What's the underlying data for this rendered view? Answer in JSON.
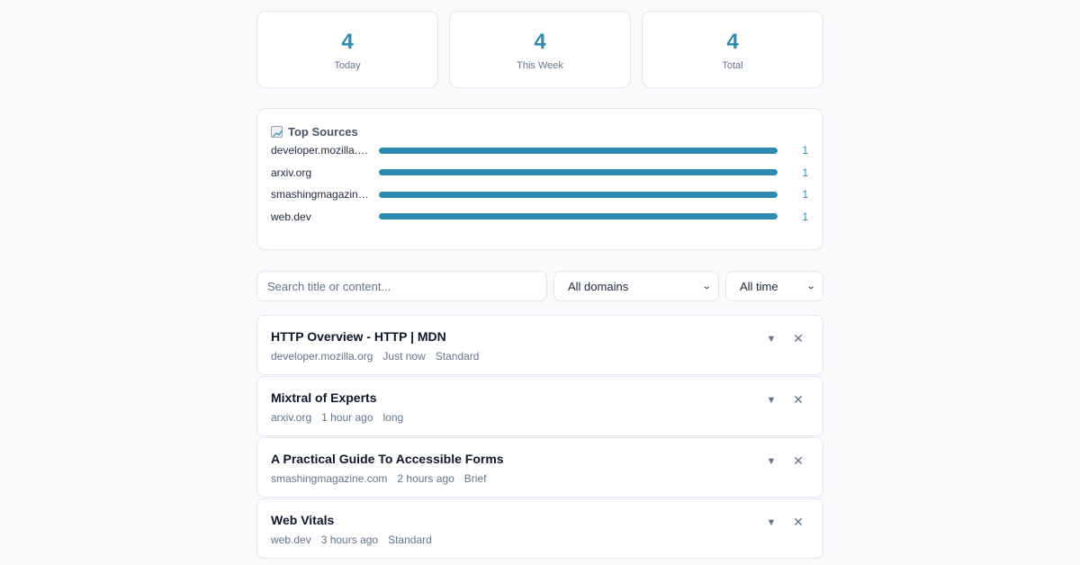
{
  "stats": [
    {
      "value": "4",
      "label": "Today"
    },
    {
      "value": "4",
      "label": "This Week"
    },
    {
      "value": "4",
      "label": "Total"
    }
  ],
  "sources": {
    "title": "Top Sources",
    "icon": "chart-icon",
    "items": [
      {
        "name": "developer.mozilla.org",
        "count": "1",
        "fraction": 1
      },
      {
        "name": "arxiv.org",
        "count": "1",
        "fraction": 1
      },
      {
        "name": "smashingmagazine.com",
        "count": "1",
        "fraction": 1
      },
      {
        "name": "web.dev",
        "count": "1",
        "fraction": 1
      }
    ]
  },
  "filters": {
    "search_placeholder": "Search title or content...",
    "domain_selected": "All domains",
    "time_selected": "All time"
  },
  "items": [
    {
      "title": "HTTP Overview - HTTP | MDN",
      "domain": "developer.mozilla.org",
      "time": "Just now",
      "length": "Standard"
    },
    {
      "title": "Mixtral of Experts",
      "domain": "arxiv.org",
      "time": "1 hour ago",
      "length": "long"
    },
    {
      "title": "A Practical Guide To Accessible Forms",
      "domain": "smashingmagazine.com",
      "time": "2 hours ago",
      "length": "Brief"
    },
    {
      "title": "Web Vitals",
      "domain": "web.dev",
      "time": "3 hours ago",
      "length": "Standard"
    }
  ],
  "colors": {
    "accent": "#2e8bb0",
    "muted": "#64748b",
    "border": "#e2e8f0"
  }
}
